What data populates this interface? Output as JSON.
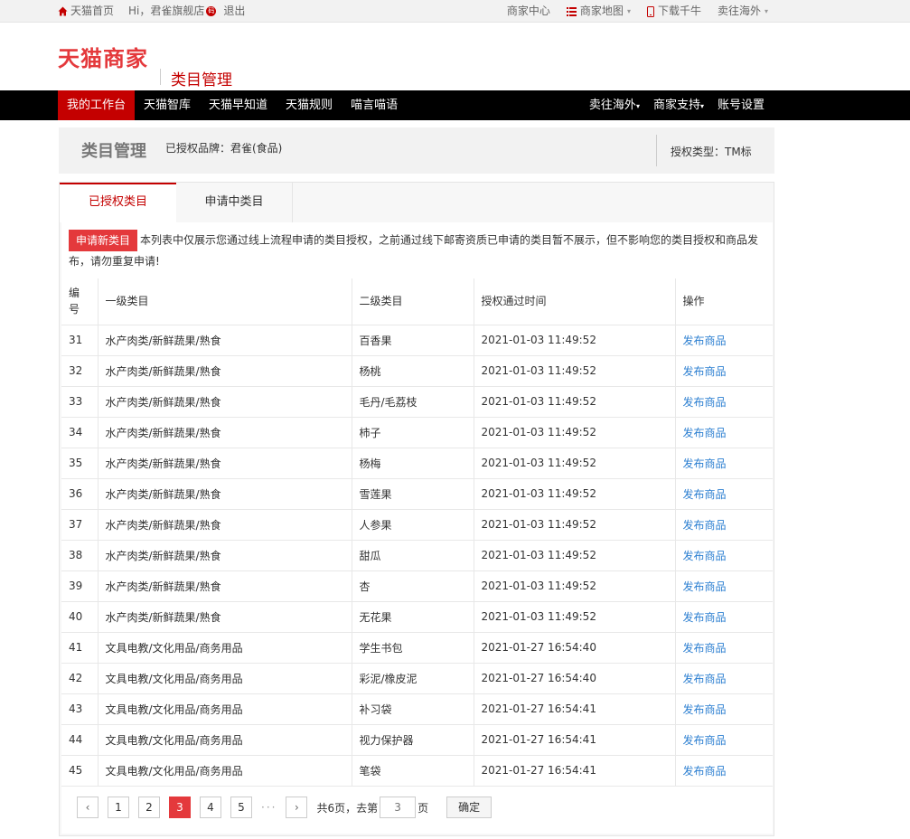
{
  "topbar": {
    "home": "天猫首页",
    "greeting": "Hi，君雀旗舰店",
    "badge": "码",
    "logout": "退出",
    "links": [
      "商家中心",
      "商家地图",
      "下载千牛",
      "卖往海外"
    ]
  },
  "header": {
    "logo": "天猫商家",
    "subtitle": "类目管理"
  },
  "nav": {
    "left": [
      "我的工作台",
      "天猫智库",
      "天猫早知道",
      "天猫规则",
      "喵言喵语"
    ],
    "right": [
      "卖往海外",
      "商家支持",
      "账号设置"
    ]
  },
  "titlebar": {
    "title": "类目管理",
    "brand": "已授权品牌：君雀(食品)",
    "type": "授权类型：TM标"
  },
  "tabs": [
    "已授权类目",
    "申请中类目"
  ],
  "notice": {
    "button": "申请新类目",
    "text": "本列表中仅展示您通过线上流程申请的类目授权，之前通过线下邮寄资质已申请的类目暂不展示，但不影响您的类目授权和商品发布，请勿重复申请!"
  },
  "table": {
    "headers": [
      "编号",
      "一级类目",
      "二级类目",
      "授权通过时间",
      "操作"
    ],
    "rows": [
      [
        "31",
        "水产肉类/新鲜蔬果/熟食",
        "百香果",
        "2021-01-03 11:49:52",
        "发布商品"
      ],
      [
        "32",
        "水产肉类/新鲜蔬果/熟食",
        "杨桃",
        "2021-01-03 11:49:52",
        "发布商品"
      ],
      [
        "33",
        "水产肉类/新鲜蔬果/熟食",
        "毛丹/毛荔枝",
        "2021-01-03 11:49:52",
        "发布商品"
      ],
      [
        "34",
        "水产肉类/新鲜蔬果/熟食",
        "柿子",
        "2021-01-03 11:49:52",
        "发布商品"
      ],
      [
        "35",
        "水产肉类/新鲜蔬果/熟食",
        "杨梅",
        "2021-01-03 11:49:52",
        "发布商品"
      ],
      [
        "36",
        "水产肉类/新鲜蔬果/熟食",
        "雪莲果",
        "2021-01-03 11:49:52",
        "发布商品"
      ],
      [
        "37",
        "水产肉类/新鲜蔬果/熟食",
        "人参果",
        "2021-01-03 11:49:52",
        "发布商品"
      ],
      [
        "38",
        "水产肉类/新鲜蔬果/熟食",
        "甜瓜",
        "2021-01-03 11:49:52",
        "发布商品"
      ],
      [
        "39",
        "水产肉类/新鲜蔬果/熟食",
        "杏",
        "2021-01-03 11:49:52",
        "发布商品"
      ],
      [
        "40",
        "水产肉类/新鲜蔬果/熟食",
        "无花果",
        "2021-01-03 11:49:52",
        "发布商品"
      ],
      [
        "41",
        "文具电教/文化用品/商务用品",
        "学生书包",
        "2021-01-27 16:54:40",
        "发布商品"
      ],
      [
        "42",
        "文具电教/文化用品/商务用品",
        "彩泥/橡皮泥",
        "2021-01-27 16:54:40",
        "发布商品"
      ],
      [
        "43",
        "文具电教/文化用品/商务用品",
        "补习袋",
        "2021-01-27 16:54:41",
        "发布商品"
      ],
      [
        "44",
        "文具电教/文化用品/商务用品",
        "视力保护器",
        "2021-01-27 16:54:41",
        "发布商品"
      ],
      [
        "45",
        "文具电教/文化用品/商务用品",
        "笔袋",
        "2021-01-27 16:54:41",
        "发布商品"
      ]
    ]
  },
  "pager": {
    "prev": "‹",
    "next": "›",
    "pages": [
      "1",
      "2",
      "3",
      "4",
      "5"
    ],
    "current": "3",
    "dots": "···",
    "total_text": "共6页，去第",
    "page_unit": "页",
    "input_placeholder": "3",
    "confirm": "确定"
  },
  "colors": {
    "brand_red": "#c40000",
    "link_blue": "#2c7fd1"
  }
}
